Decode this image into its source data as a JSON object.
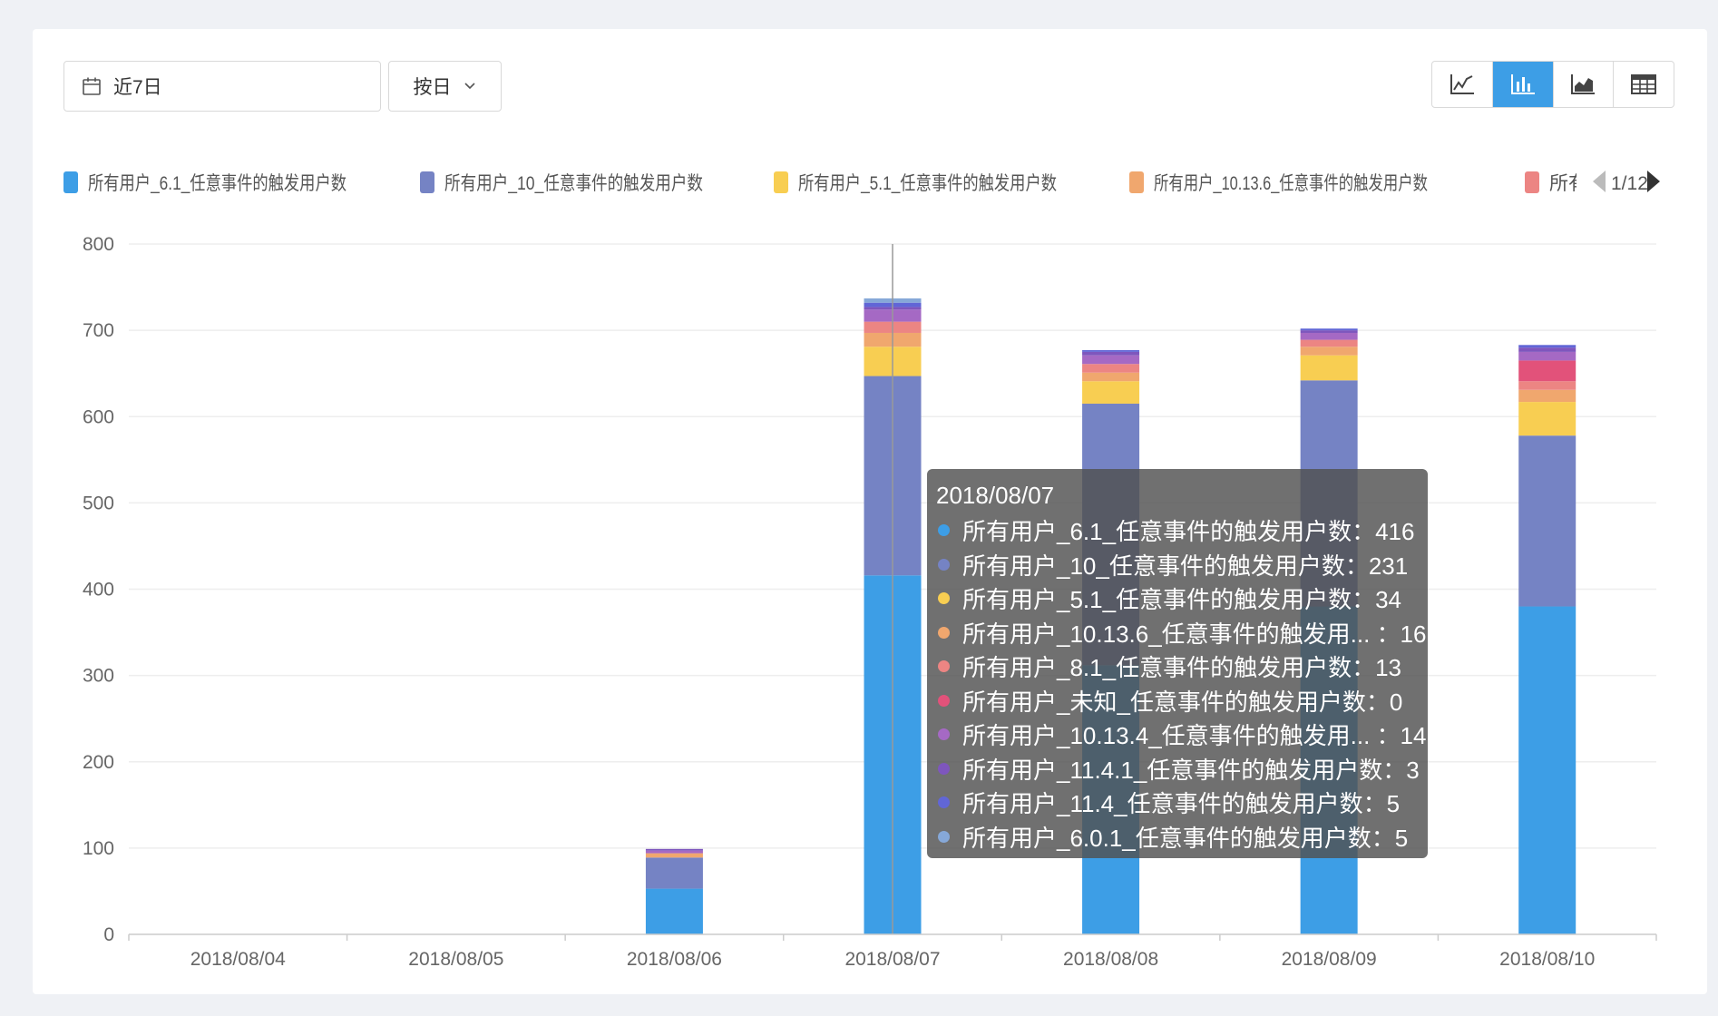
{
  "filters": {
    "date_range": "近7日",
    "granularity": "按日"
  },
  "chart_types": [
    {
      "icon": "line-chart-icon",
      "active": false
    },
    {
      "icon": "bar-chart-icon",
      "active": true
    },
    {
      "icon": "area-chart-icon",
      "active": false
    },
    {
      "icon": "table-icon",
      "active": false
    }
  ],
  "legend": {
    "page": "1/12",
    "truncated_item": "所有"
  },
  "tooltip": {
    "title": "2018/08/07",
    "rows": [
      {
        "label": "所有用户_6.1_任意事件的触发用户数：416",
        "color": "#3d9ee6"
      },
      {
        "label": "所有用户_10_任意事件的触发用户数：231",
        "color": "#7583c4"
      },
      {
        "label": "所有用户_5.1_任意事件的触发用户数：34",
        "color": "#f8ce52"
      },
      {
        "label": "所有用户_10.13.6_任意事件的触发用...  ：16",
        "color": "#f0a76e"
      },
      {
        "label": "所有用户_8.1_任意事件的触发用户数：13",
        "color": "#ec8583"
      },
      {
        "label": "所有用户_未知_任意事件的触发用户数：0",
        "color": "#e2527a"
      },
      {
        "label": "所有用户_10.13.4_任意事件的触发用...  ：14",
        "color": "#a569c4"
      },
      {
        "label": "所有用户_11.4.1_任意事件的触发用户数：3",
        "color": "#7e56bd"
      },
      {
        "label": "所有用户_11.4_任意事件的触发用户数：5",
        "color": "#6166d6"
      },
      {
        "label": "所有用户_6.0.1_任意事件的触发用户数：5",
        "color": "#86a8d8"
      }
    ]
  },
  "chart_data": {
    "type": "bar",
    "stacked": true,
    "categories": [
      "2018/08/04",
      "2018/08/05",
      "2018/08/06",
      "2018/08/07",
      "2018/08/08",
      "2018/08/09",
      "2018/08/10"
    ],
    "ylim": [
      0,
      800
    ],
    "yticks": [
      0,
      100,
      200,
      300,
      400,
      500,
      600,
      700,
      800
    ],
    "grid": true,
    "legend_position": "top",
    "highlight_category": "2018/08/07",
    "series": [
      {
        "name": "所有用户_6.1_任意事件的触发用户数",
        "color": "#3d9ee6",
        "values": [
          0,
          0,
          53,
          416,
          312,
          380,
          380
        ]
      },
      {
        "name": "所有用户_10_任意事件的触发用户数",
        "color": "#7583c4",
        "values": [
          0,
          0,
          36,
          231,
          303,
          262,
          198
        ]
      },
      {
        "name": "所有用户_5.1_任意事件的触发用户数",
        "color": "#f8ce52",
        "values": [
          0,
          0,
          0,
          34,
          26,
          29,
          39
        ]
      },
      {
        "name": "所有用户_10.13.6_任意事件的触发用户数",
        "color": "#f0a76e",
        "values": [
          0,
          0,
          5,
          16,
          10,
          10,
          14
        ]
      },
      {
        "name": "所有用户_8.1_任意事件的触发用户数",
        "color": "#ec8583",
        "values": [
          0,
          0,
          0,
          13,
          10,
          8,
          10
        ]
      },
      {
        "name": "所有用户_未知_任意事件的触发用户数",
        "color": "#e2527a",
        "values": [
          0,
          0,
          0,
          0,
          0,
          0,
          24
        ]
      },
      {
        "name": "所有用户_10.13.4_任意事件的触发用户数",
        "color": "#a569c4",
        "values": [
          0,
          0,
          3,
          14,
          10,
          8,
          10
        ]
      },
      {
        "name": "所有用户_11.4.1_任意事件的触发用户数",
        "color": "#7e56bd",
        "values": [
          0,
          0,
          2,
          3,
          4,
          3,
          5
        ]
      },
      {
        "name": "所有用户_11.4_任意事件的触发用户数",
        "color": "#6166d6",
        "values": [
          0,
          0,
          0,
          5,
          2,
          2,
          3
        ]
      },
      {
        "name": "所有用户_6.0.1_任意事件的触发用户数",
        "color": "#86a8d8",
        "values": [
          0,
          0,
          0,
          5,
          0,
          0,
          0
        ]
      }
    ]
  }
}
